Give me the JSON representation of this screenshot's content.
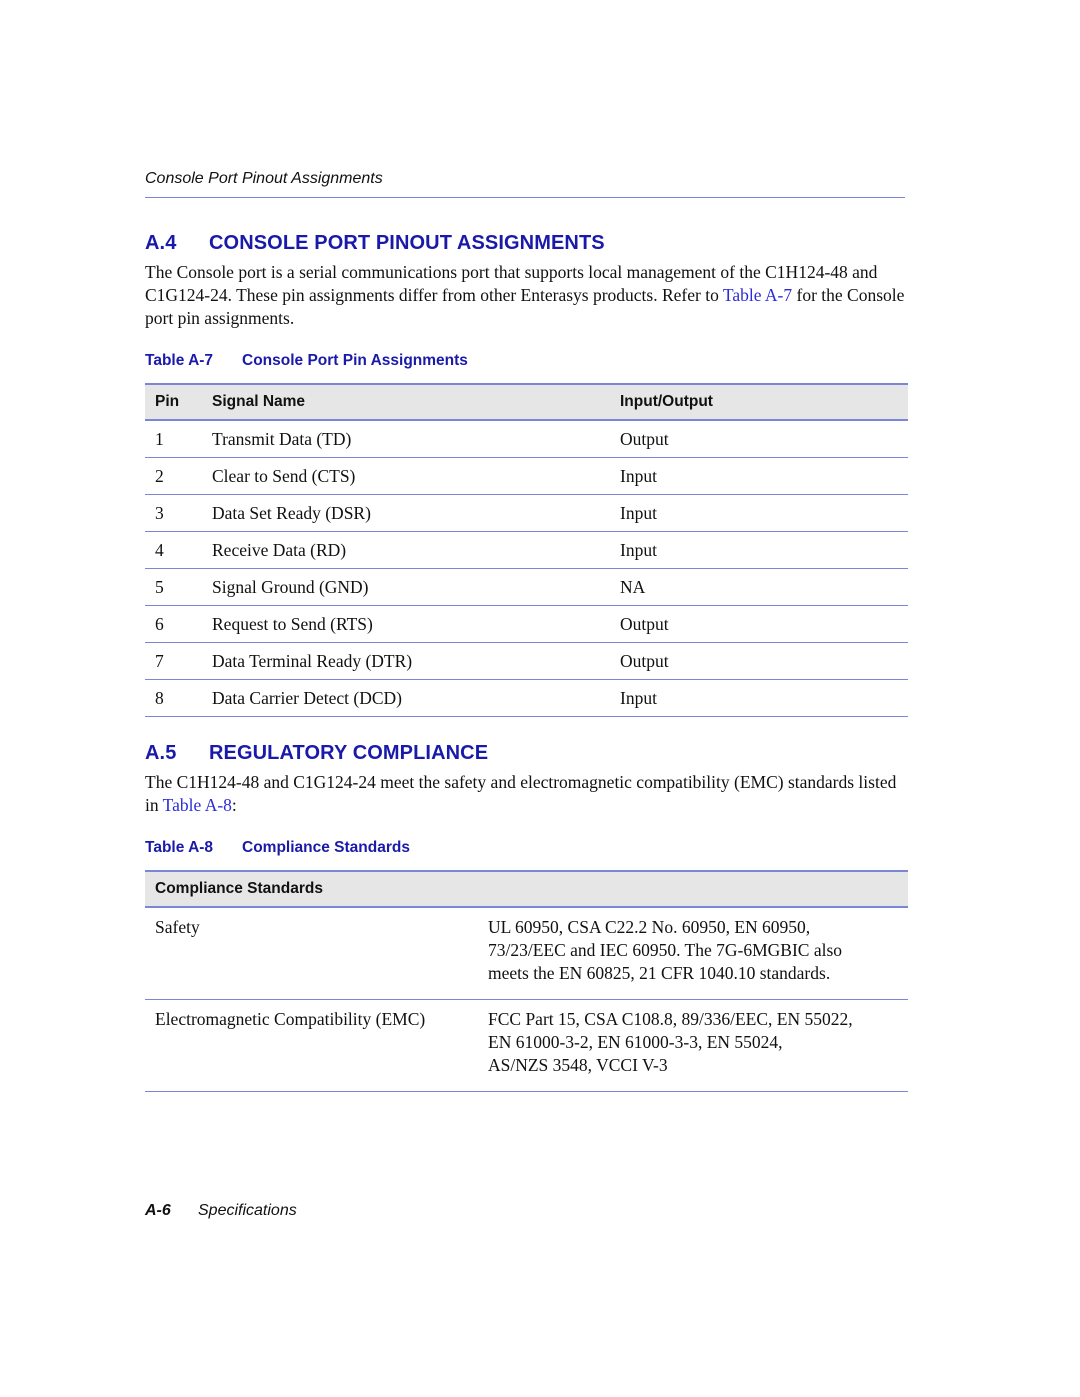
{
  "running_head": "Console Port Pinout Assignments",
  "section_a4": {
    "number": "A.4",
    "title": "CONSOLE PORT PINOUT ASSIGNMENTS",
    "para_before_link": "The Console port is a serial communications port that supports local management of the C1H124-48 and C1G124-24. These pin assignments differ from other Enterasys products. Refer to ",
    "link": "Table A-7",
    "para_after_link": " for the Console port pin assignments."
  },
  "table_a7": {
    "caption_number": "Table A-7",
    "caption_title": "Console Port Pin Assignments",
    "headers": [
      "Pin",
      "Signal Name",
      "Input/Output"
    ],
    "rows": [
      [
        "1",
        "Transmit Data (TD)",
        "Output"
      ],
      [
        "2",
        "Clear to Send (CTS)",
        "Input"
      ],
      [
        "3",
        "Data Set Ready (DSR)",
        "Input"
      ],
      [
        "4",
        "Receive Data (RD)",
        "Input"
      ],
      [
        "5",
        "Signal Ground (GND)",
        "NA"
      ],
      [
        "6",
        "Request to Send (RTS)",
        "Output"
      ],
      [
        "7",
        "Data Terminal Ready (DTR)",
        "Output"
      ],
      [
        "8",
        "Data Carrier Detect (DCD)",
        "Input"
      ]
    ]
  },
  "section_a5": {
    "number": "A.5",
    "title": "REGULATORY COMPLIANCE",
    "para_before_link": "The C1H124-48 and C1G124-24 meet the safety and electromagnetic compatibility (EMC) standards listed in ",
    "link": "Table A-8",
    "para_after_link": ":"
  },
  "table_a8": {
    "caption_number": "Table A-8",
    "caption_title": "Compliance Standards",
    "header": "Compliance Standards",
    "rows": [
      {
        "category": "Safety",
        "lines": [
          "UL 60950, CSA C22.2 No. 60950, EN 60950,",
          "73/23/EEC and IEC 60950. The 7G-6MGBIC also",
          "meets the EN 60825, 21 CFR 1040.10 standards."
        ]
      },
      {
        "category": "Electromagnetic Compatibility (EMC)",
        "lines": [
          "FCC Part 15, CSA C108.8, 89/336/EEC, EN 55022,",
          "EN 61000-3-2, EN 61000-3-3, EN 55024,",
          "AS/NZS 3548, VCCI V-3"
        ]
      }
    ]
  },
  "footer": {
    "page_number": "A-6",
    "chapter": "Specifications"
  }
}
